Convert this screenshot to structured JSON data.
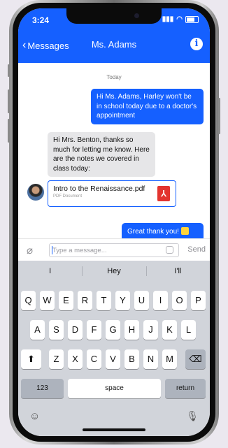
{
  "status": {
    "time": "3:24",
    "signal": "▮▮▮"
  },
  "nav": {
    "back_label": "Messages",
    "title": "Ms. Adams",
    "info_icon": "i"
  },
  "messages": {
    "day_label": "Today",
    "items": [
      {
        "direction": "outgoing",
        "text": "Hi Ms. Adams, Harley won't be in school today due to a doctor's appointment"
      },
      {
        "direction": "incoming",
        "text": "Hi Mrs. Benton, thanks so much for letting me know. Here are the notes we covered in class today:"
      },
      {
        "direction": "outgoing",
        "text": "Great thank you!"
      }
    ],
    "attachment": {
      "file_name": "Intro to the Renaissance.pdf",
      "file_type": "PDF Document"
    }
  },
  "composer": {
    "placeholder": "Type a message...",
    "value": "",
    "send_label": "Send"
  },
  "keyboard": {
    "suggestions": [
      "I",
      "Hey",
      "I'll"
    ],
    "row1": [
      "Q",
      "W",
      "E",
      "R",
      "T",
      "Y",
      "U",
      "I",
      "O",
      "P"
    ],
    "row2": [
      "A",
      "S",
      "D",
      "F",
      "G",
      "H",
      "J",
      "K",
      "L"
    ],
    "row3": [
      "Z",
      "X",
      "C",
      "V",
      "B",
      "N",
      "M"
    ],
    "numbers_label": "123",
    "space_label": "space",
    "return_label": "return",
    "shift_glyph": "⬆",
    "backspace_glyph": "⌫"
  },
  "icons": {
    "paperclip": "paperclip-icon",
    "pdf": "pdf-icon",
    "emoji": "emoji-icon",
    "mic": "microphone-icon",
    "info": "info-icon"
  },
  "colors": {
    "accent": "#1560ff",
    "incoming_bubble": "#e6e6e8",
    "keyboard_bg": "#d1d4da",
    "pdf_red": "#e3342f"
  }
}
